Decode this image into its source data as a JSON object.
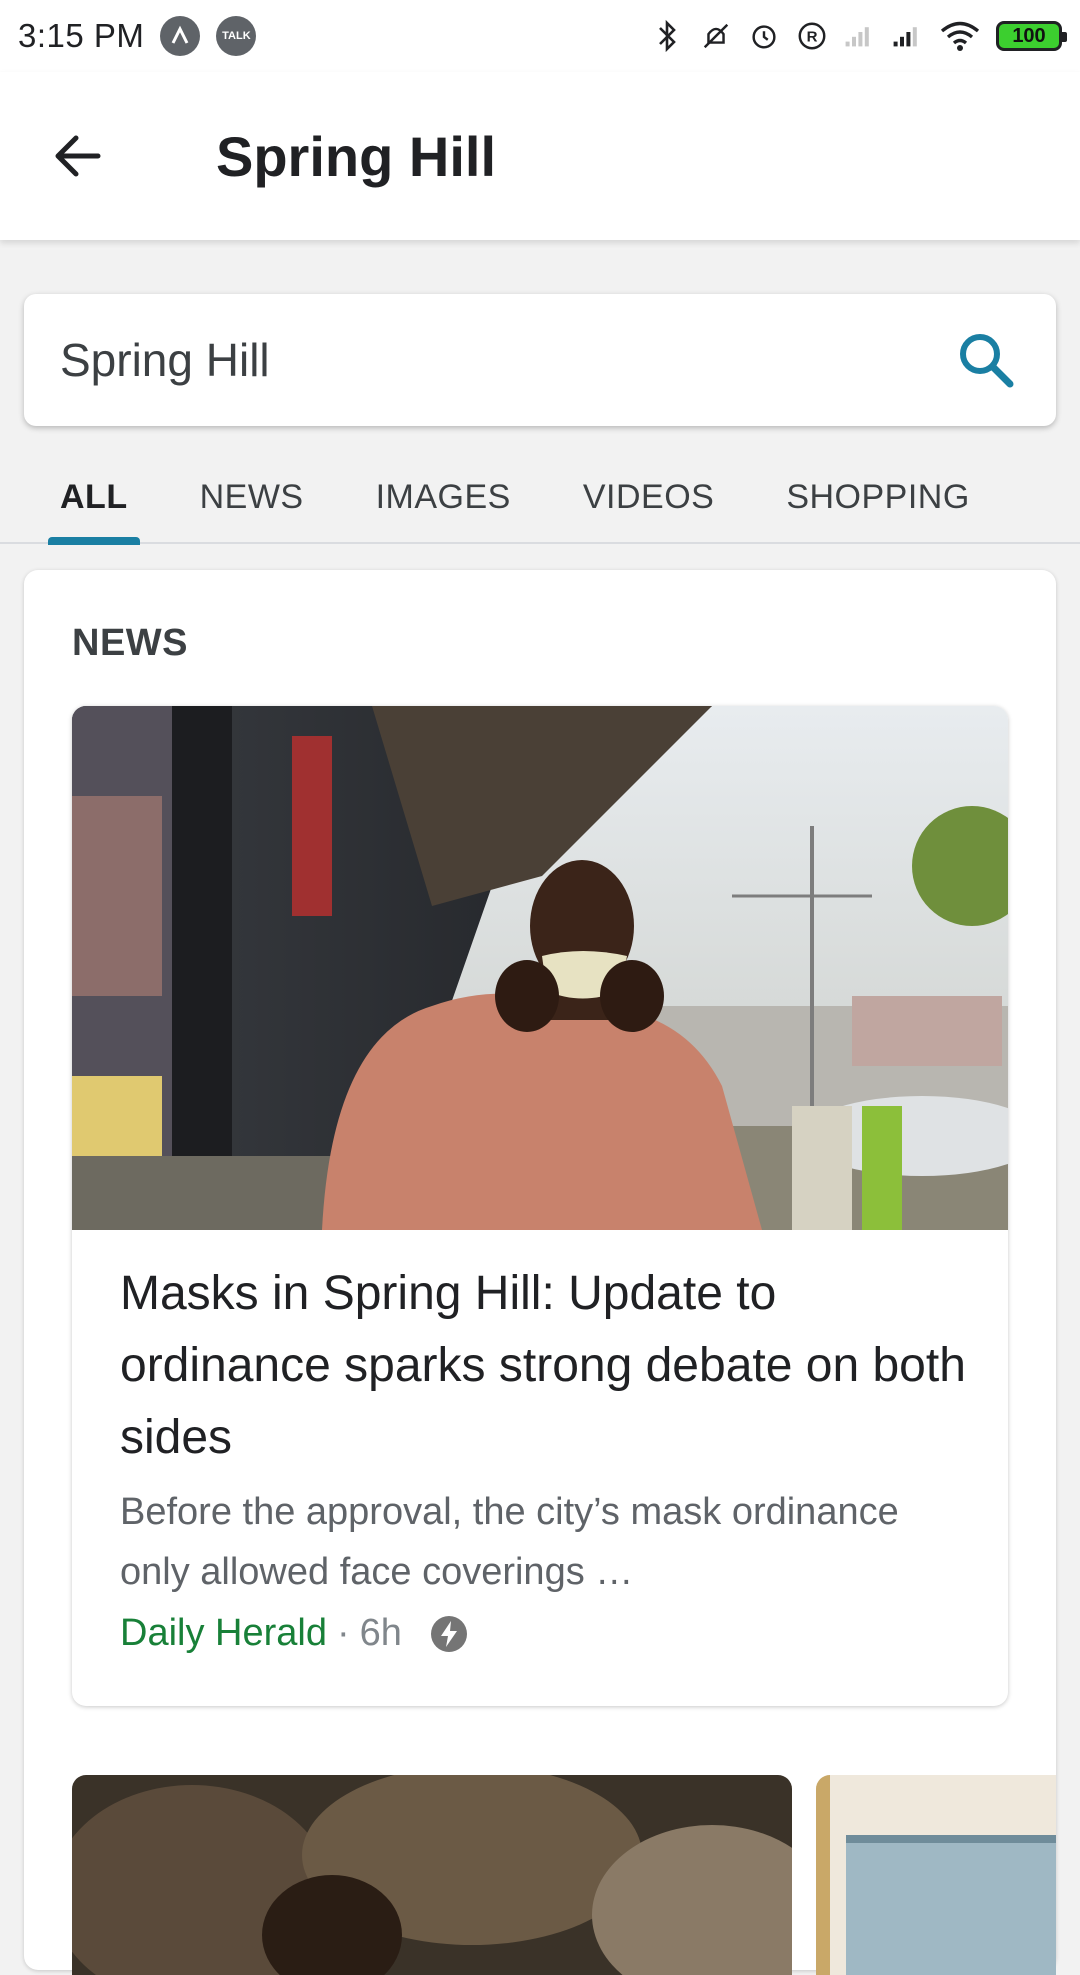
{
  "status_bar": {
    "time": "3:15 PM",
    "talk_badge": "TALK",
    "battery": "100"
  },
  "app_bar": {
    "title": "Spring Hill"
  },
  "search": {
    "value": "Spring Hill"
  },
  "tabs": [
    {
      "label": "ALL",
      "active": true
    },
    {
      "label": "NEWS",
      "active": false
    },
    {
      "label": "IMAGES",
      "active": false
    },
    {
      "label": "VIDEOS",
      "active": false
    },
    {
      "label": "SHOPPING",
      "active": false
    }
  ],
  "news_card": {
    "heading": "NEWS",
    "article": {
      "title": "Masks in Spring Hill: Update to ordinance sparks strong debate on both sides",
      "snippet": "Before the approval, the city’s mask ordinance only allowed face coverings …",
      "source": "Daily Herald",
      "separator": "·",
      "age": "6h",
      "image_alt": "Man adjusting face mask outside pizza shop"
    }
  },
  "colors": {
    "accent": "#1a7fa3",
    "source_green": "#188038",
    "battery_green": "#3ccf2f"
  }
}
